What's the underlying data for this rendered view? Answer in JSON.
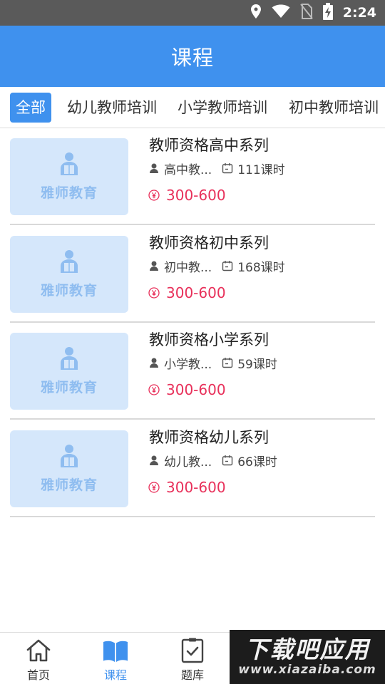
{
  "status_bar": {
    "time": "2:24",
    "icons": [
      "location-icon",
      "wifi-icon",
      "no-sim-icon",
      "battery-charging-icon"
    ]
  },
  "header": {
    "title": "课程"
  },
  "tabs": [
    {
      "label": "全部",
      "active": true
    },
    {
      "label": "幼儿教师培训"
    },
    {
      "label": "小学教师培训"
    },
    {
      "label": "初中教师培训"
    }
  ],
  "courses": [
    {
      "thumb_text": "雅师教育",
      "title": "教师资格高中系列",
      "teacher": "高中教...",
      "hours": "111课时",
      "price": "300-600"
    },
    {
      "thumb_text": "雅师教育",
      "title": "教师资格初中系列",
      "teacher": "初中教...",
      "hours": "168课时",
      "price": "300-600"
    },
    {
      "thumb_text": "雅师教育",
      "title": "教师资格小学系列",
      "teacher": "小学教...",
      "hours": "59课时",
      "price": "300-600"
    },
    {
      "thumb_text": "雅师教育",
      "title": "教师资格幼儿系列",
      "teacher": "幼儿教...",
      "hours": "66课时",
      "price": "300-600"
    }
  ],
  "bottom_nav": [
    {
      "label": "首页",
      "icon": "home-icon"
    },
    {
      "label": "课程",
      "icon": "book-icon",
      "active": true
    },
    {
      "label": "题库",
      "icon": "clipboard-check-icon"
    },
    {
      "label": "",
      "icon": ""
    },
    {
      "label": "",
      "icon": ""
    }
  ],
  "watermark": {
    "main": "下载吧应用",
    "sub": "www.xiazaiba.com"
  },
  "colors": {
    "primary": "#3f91ee",
    "price": "#e8305a",
    "thumb_bg": "#d5e7fb",
    "status_bar": "#5a5a5a"
  }
}
